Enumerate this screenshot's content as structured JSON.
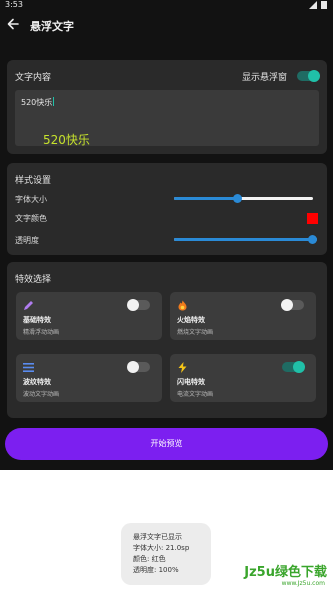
{
  "status_bar": {
    "time": "3:53"
  },
  "app": {
    "title": "悬浮文字"
  },
  "text_card": {
    "title": "文字内容",
    "show_floating_label": "显示悬浮窗",
    "show_floating_on": true,
    "input_value": "520快乐",
    "preview_text": "520快乐",
    "preview_color": "#c6e22c"
  },
  "style_card": {
    "title": "样式设置",
    "font_size_label": "字体大小",
    "font_size_fraction": 0.45,
    "font_color_label": "文字颜色",
    "font_color": "#ff0000",
    "opacity_label": "透明度",
    "opacity_fraction": 1.0
  },
  "effects_card": {
    "title": "特效选择",
    "effects": [
      {
        "name": "基础特效",
        "desc": "精滑浮动动画",
        "icon": "pencil-icon",
        "enabled": false
      },
      {
        "name": "火焰特效",
        "desc": "燃烧文字动画",
        "icon": "flame-icon",
        "enabled": false
      },
      {
        "name": "波纹特效",
        "desc": "波动文字动画",
        "icon": "waves-icon",
        "enabled": false
      },
      {
        "name": "闪电特效",
        "desc": "电流文字动画",
        "icon": "lightning-icon",
        "enabled": true
      }
    ]
  },
  "start_button": {
    "label": "开始预览"
  },
  "toast": {
    "line1": "悬浮文字已显示",
    "line2": "字体大小: 21.0sp",
    "line3": "颜色: 红色",
    "line4": "透明度: 100%"
  },
  "watermark": {
    "brand": "Jz5u绿色下载",
    "url": "www.Jz5u.com"
  },
  "colors": {
    "accent": "#7c1ff0",
    "switch_on": "#20c0a8",
    "slider": "#2a8ad6",
    "background": "#121212",
    "card": "#2a2a2a"
  }
}
